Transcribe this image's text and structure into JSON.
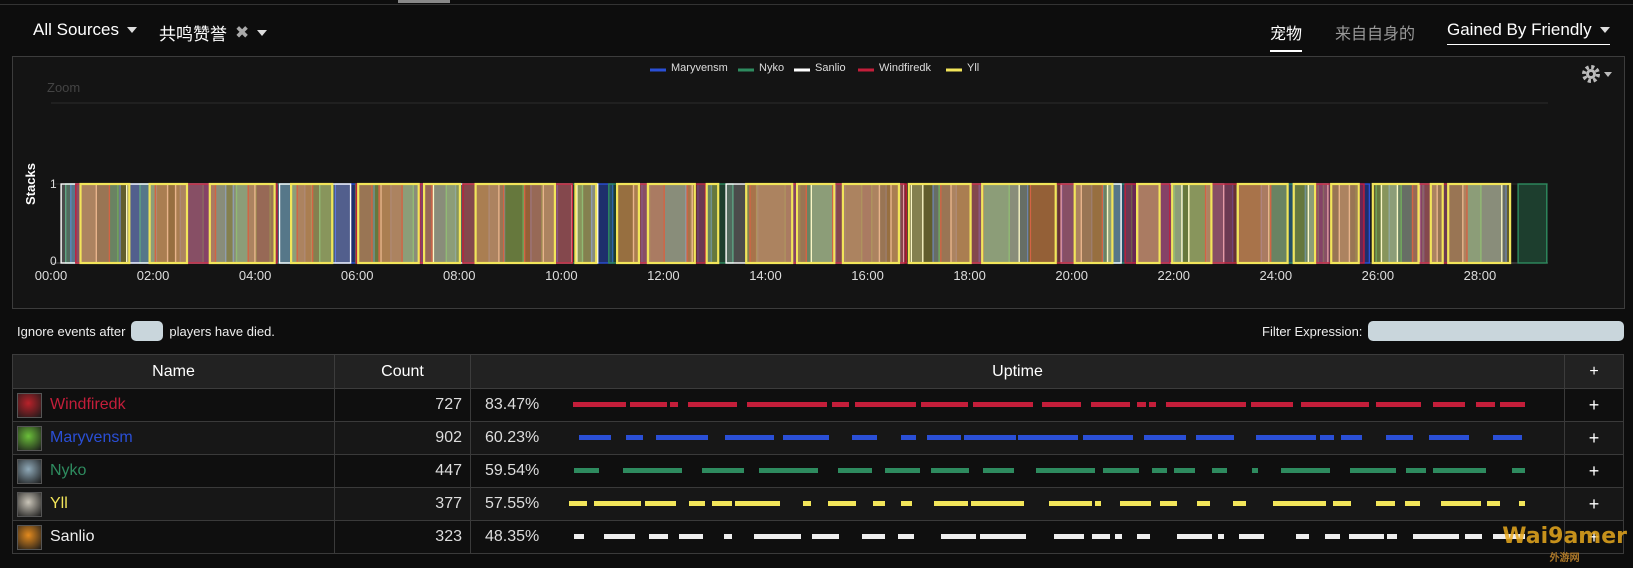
{
  "toolbar": {
    "source_label": "All Sources",
    "aura_label": "共鸣赞誉",
    "tab_pet": "宠物",
    "tab_self": "来自自身的",
    "mode_label": "Gained By Friendly"
  },
  "chart_data": {
    "type": "area",
    "title": "",
    "zoom_label": "Zoom",
    "ylabel": "Stacks",
    "ylim": [
      0,
      1
    ],
    "y_ticks": [
      "0",
      "1"
    ],
    "xlabel": "",
    "xlim": [
      "00:00",
      "29:20"
    ],
    "x_ticks": [
      "00:00",
      "02:00",
      "04:00",
      "06:00",
      "08:00",
      "10:00",
      "12:00",
      "14:00",
      "16:00",
      "18:00",
      "20:00",
      "22:00",
      "24:00",
      "26:00",
      "28:00"
    ],
    "legend_position": "top-center",
    "series": [
      {
        "name": "Maryvensm",
        "color": "#2a4fd6"
      },
      {
        "name": "Nyko",
        "color": "#2e8b5f"
      },
      {
        "name": "Sanlio",
        "color": "#ffffff"
      },
      {
        "name": "Windfiredk",
        "color": "#c41e3a"
      },
      {
        "name": "Yll",
        "color": "#f2e55a"
      }
    ]
  },
  "controls": {
    "ignore_prefix": "Ignore events after",
    "ignore_suffix": "players have died.",
    "filter_label": "Filter Expression:"
  },
  "table": {
    "headers": {
      "name": "Name",
      "count": "Count",
      "uptime": "Uptime",
      "plus": "+"
    },
    "rows": [
      {
        "name": "Windfiredk",
        "count": "727",
        "uptime": "83.47%",
        "color": "#c41e3a",
        "icon": "death-knight-icon"
      },
      {
        "name": "Maryvensm",
        "count": "902",
        "uptime": "60.23%",
        "color": "#2a4fd6",
        "icon": "shaman-icon"
      },
      {
        "name": "Nyko",
        "count": "447",
        "uptime": "59.54%",
        "color": "#2e8b5f",
        "icon": "wolf-icon"
      },
      {
        "name": "Yll",
        "count": "377",
        "uptime": "57.55%",
        "color": "#f2e55a",
        "icon": "warrior-icon"
      },
      {
        "name": "Sanlio",
        "count": "323",
        "uptime": "48.35%",
        "color": "#eeeeee",
        "icon": "priest-icon"
      }
    ]
  },
  "watermark": {
    "text": "Wai9amer",
    "sub": "外游网"
  }
}
